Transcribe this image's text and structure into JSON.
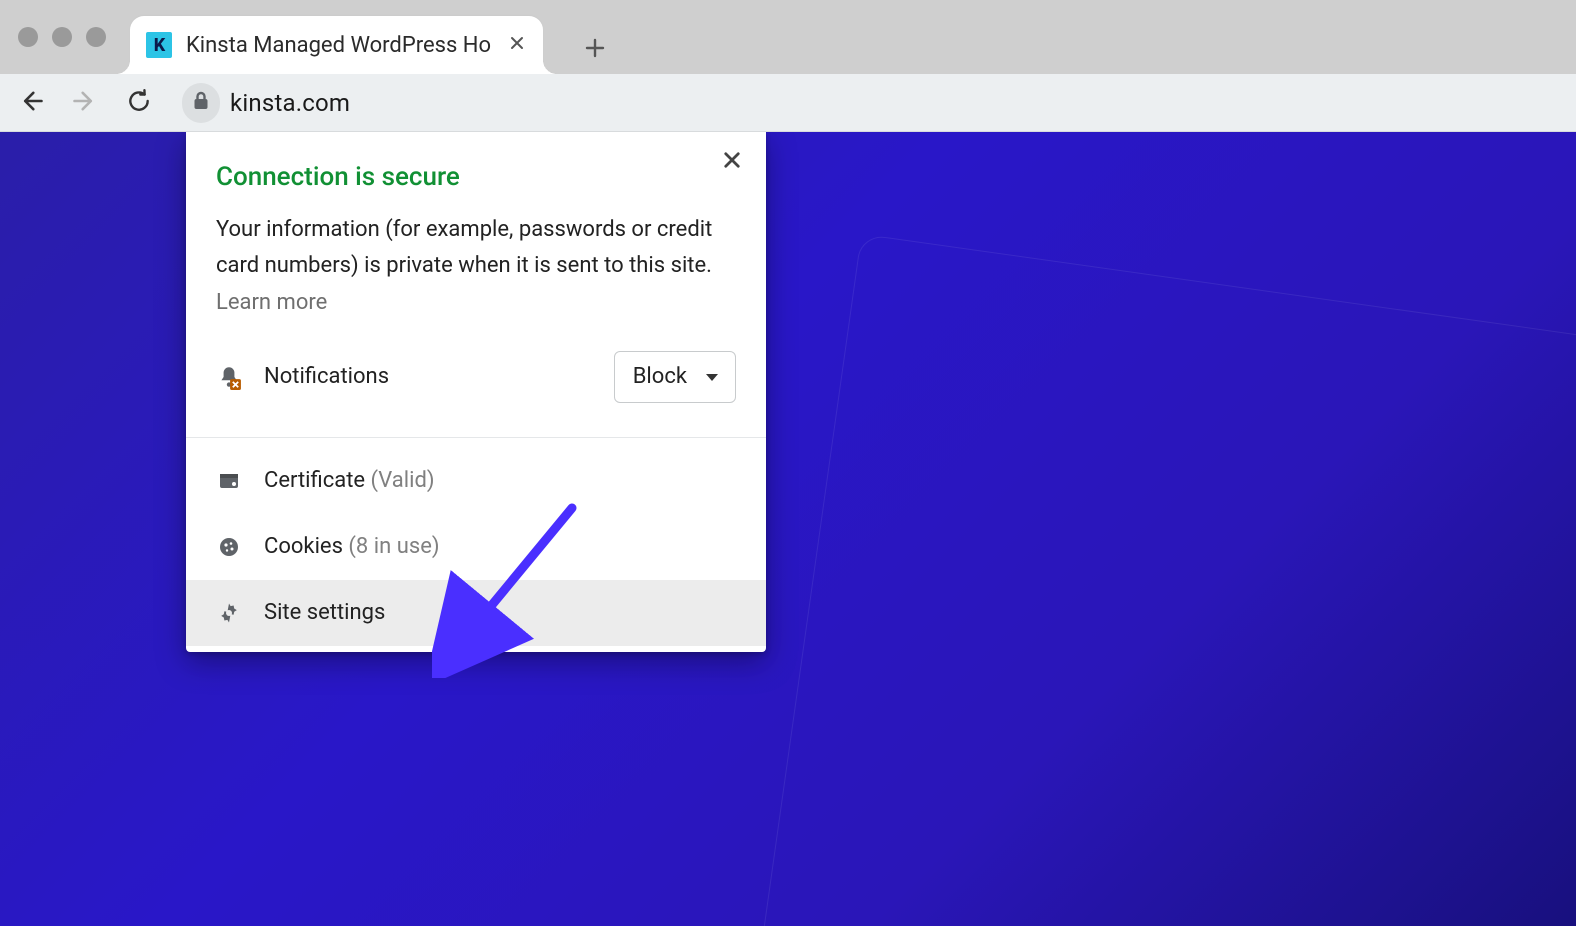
{
  "browser": {
    "tab_title": "Kinsta Managed WordPress Ho",
    "favicon_letter": "K",
    "url": "kinsta.com"
  },
  "popup": {
    "title": "Connection is secure",
    "description": "Your information (for example, passwords or credit card numbers) is private when it is sent to this site.",
    "learn_more": "Learn more",
    "notifications_label": "Notifications",
    "notifications_value": "Block",
    "certificate_label": "Certificate",
    "certificate_status": "(Valid)",
    "cookies_label": "Cookies",
    "cookies_status": "(8 in use)",
    "site_settings_label": "Site settings"
  }
}
